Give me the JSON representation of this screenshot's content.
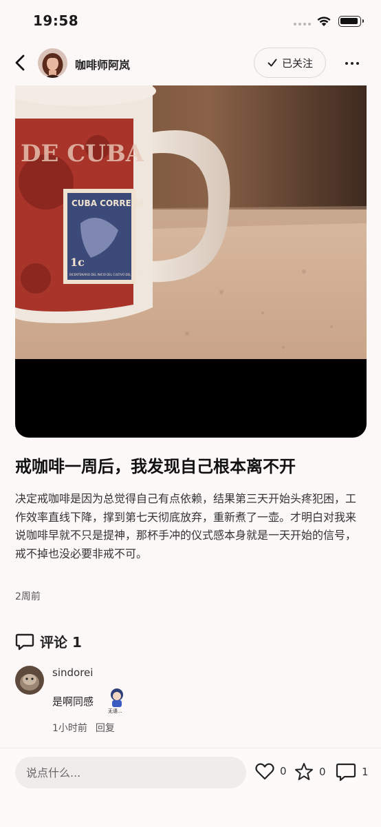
{
  "status_bar": {
    "time": "19:58"
  },
  "header": {
    "author_name": "咖啡师阿岚",
    "follow_label": "已关注"
  },
  "post": {
    "image_text": {
      "stamp": "CUBA CORREOS",
      "denomination": "1c",
      "banner": "DE CUBA",
      "subtitle": "BICENTENARIO DEL INICIO DEL CULTIVO DEL CAFE"
    },
    "title": "戒咖啡一周后，我发现自己根本离不开",
    "body": "决定戒咖啡是因为总觉得自己有点依赖，结果第三天开始头疼犯困，工作效率直线下降，撑到第七天彻底放弃，重新煮了一壶。才明白对我来说咖啡早就不只是提神，那杯手冲的仪式感本身就是一天开始的信号，戒不掉也没必要非戒不可。",
    "time": "2周前"
  },
  "comments": {
    "label": "评论 1",
    "items": [
      {
        "user": "sindorei",
        "text": "是啊同感",
        "sticker_text": "无语...",
        "time": "1小时前",
        "reply_label": "回复"
      }
    ]
  },
  "bottom_bar": {
    "input_placeholder": "说点什么...",
    "like_count": "0",
    "favorite_count": "0",
    "comment_count": "1"
  },
  "icons": {
    "back": "chevron-left-icon",
    "check": "check-icon",
    "more": "more-dots-icon",
    "comment": "comment-bubble-icon",
    "like": "heart-icon",
    "favorite": "star-icon"
  },
  "colors": {
    "background": "#fcf8f8",
    "text_primary": "#111111",
    "input_bg": "#f1ecec"
  }
}
